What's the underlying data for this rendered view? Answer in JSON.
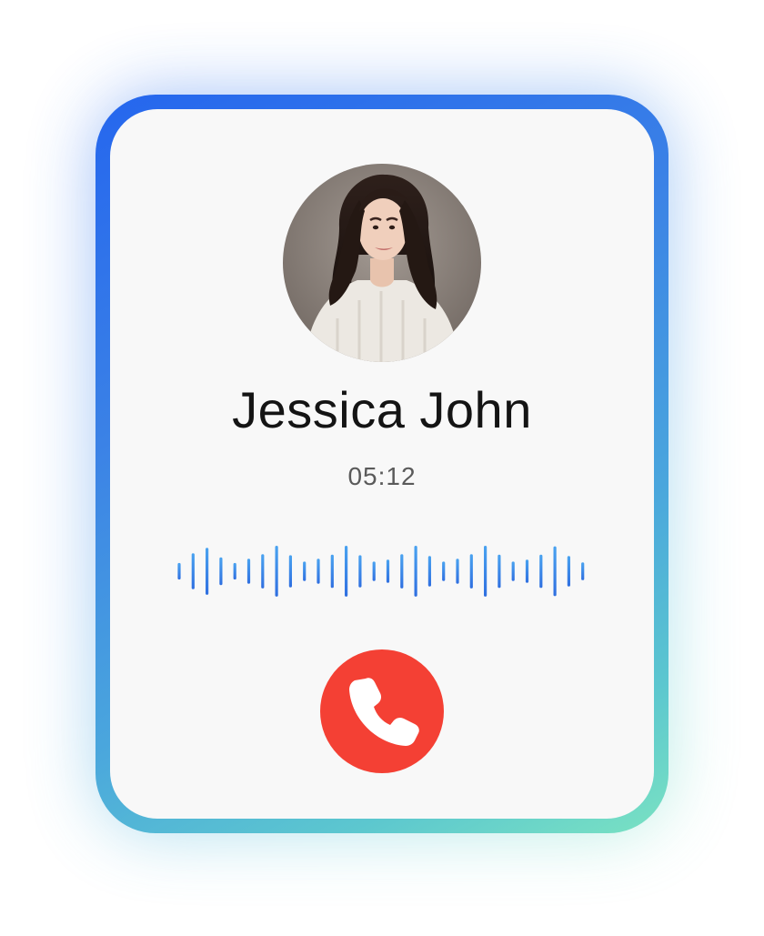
{
  "call": {
    "caller_name": "Jessica John",
    "duration": "05:12",
    "status": "active"
  },
  "icons": {
    "hangup": "phone-hangup-icon",
    "avatar": "caller-avatar"
  },
  "colors": {
    "accent_gradient_start": "#2566ee",
    "accent_gradient_end": "#7ae2c2",
    "waveform_top": "#4aa3f0",
    "waveform_bottom": "#2f6fe0",
    "hangup_button": "#f44034",
    "card_background": "#f8f8f8"
  },
  "waveform": {
    "bars": 30,
    "levels": [
      0.3,
      0.65,
      0.85,
      0.5,
      0.3,
      0.45,
      0.62,
      0.92,
      0.58,
      0.35,
      0.45,
      0.6,
      0.92,
      0.58,
      0.35,
      0.42,
      0.62,
      0.92,
      0.55,
      0.35,
      0.45,
      0.62,
      0.92,
      0.6,
      0.35,
      0.42,
      0.6,
      0.9,
      0.55,
      0.32
    ]
  }
}
